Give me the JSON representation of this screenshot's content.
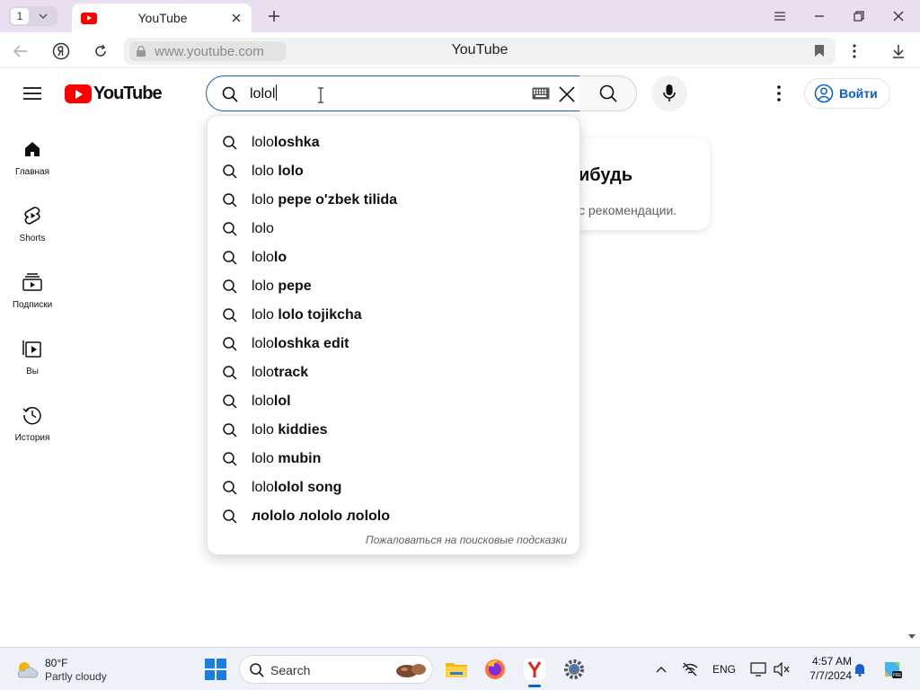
{
  "browser": {
    "tab_count": "1",
    "tab_title": "YouTube",
    "url": "www.youtube.com",
    "page_title": "YouTube"
  },
  "youtube": {
    "logo_text": "YouTube",
    "search_query": "lolol",
    "sign_in_label": "Войти"
  },
  "sidebar": {
    "items": [
      {
        "label": "Главная",
        "icon": "home-icon"
      },
      {
        "label": "Shorts",
        "icon": "shorts-icon"
      },
      {
        "label": "Подписки",
        "icon": "subscriptions-icon"
      },
      {
        "label": "Вы",
        "icon": "you-icon"
      },
      {
        "label": "История",
        "icon": "history-icon"
      }
    ]
  },
  "card": {
    "heading_partial": "ибудь",
    "text_partial": "с рекомендации."
  },
  "suggestions": [
    {
      "prefix": "lolo",
      "rest": "loshka"
    },
    {
      "prefix": "lolo",
      "rest": " lolo"
    },
    {
      "prefix": "lolo",
      "rest": " pepe o'zbek tilida"
    },
    {
      "prefix": "lolo",
      "rest": ""
    },
    {
      "prefix": "lolo",
      "rest": "lo"
    },
    {
      "prefix": "lolo",
      "rest": " pepe"
    },
    {
      "prefix": "lolo",
      "rest": " lolo tojikcha"
    },
    {
      "prefix": "lolo",
      "rest": "loshka edit"
    },
    {
      "prefix": "lolo",
      "rest": "track"
    },
    {
      "prefix": "lolo",
      "rest": "lol"
    },
    {
      "prefix": "lolo",
      "rest": " kiddies"
    },
    {
      "prefix": "lolo",
      "rest": " mubin"
    },
    {
      "prefix": "lolo",
      "rest": "lolol song"
    },
    {
      "prefix": "",
      "rest": "лololo лololo лololo"
    }
  ],
  "report_link": "Пожаловаться на поисковые подсказки",
  "taskbar": {
    "weather_temp": "80°F",
    "weather_desc": "Partly cloudy",
    "search_label": "Search",
    "language": "ENG",
    "time": "4:57 AM",
    "date": "7/7/2024"
  },
  "colors": {
    "yt_red": "#ff0000",
    "link_blue": "#065fd4",
    "focus_blue": "#1c62b9"
  }
}
